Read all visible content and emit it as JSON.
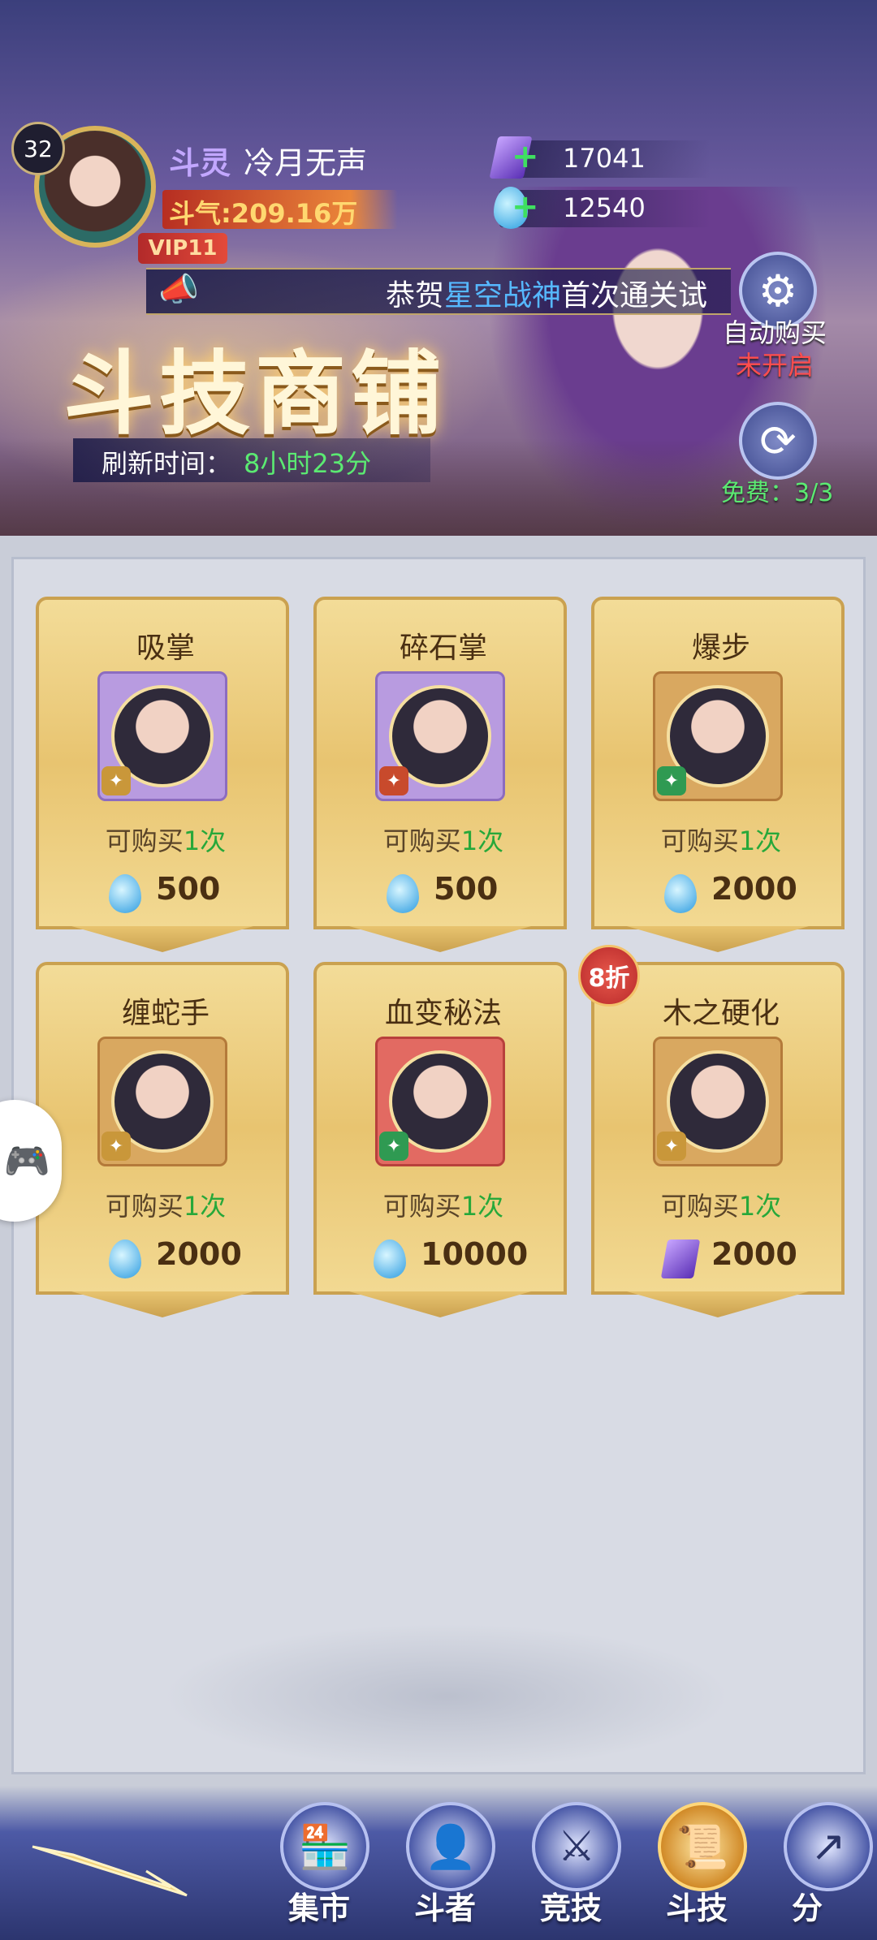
{
  "player": {
    "level": "32",
    "rank": "斗灵",
    "name": "冷月无声",
    "power": "斗气:209.16万",
    "vip": "VIP11"
  },
  "currencies": [
    {
      "icon": "purple-crystal-icon",
      "value": "17041"
    },
    {
      "icon": "blue-drop-icon",
      "value": "12540"
    }
  ],
  "notice": {
    "prefix": "恭贺",
    "highlight": "星空战神",
    "suffix": "首次通关试"
  },
  "shop": {
    "title": "斗技商铺",
    "refresh_label": "刷新时间：",
    "refresh_value": "8小时23分",
    "auto_buy_label": "自动购买",
    "auto_buy_status": "未开启",
    "free_refresh": "免费：3/3"
  },
  "items": [
    {
      "name": "吸掌",
      "limit_prefix": "可购买",
      "limit_count": "1次",
      "price": "500",
      "currency": "drop",
      "frame": "purple",
      "badge_color": "#c9973a"
    },
    {
      "name": "碎石掌",
      "limit_prefix": "可购买",
      "limit_count": "1次",
      "price": "500",
      "currency": "drop",
      "frame": "purple",
      "badge_color": "#c84a2c"
    },
    {
      "name": "爆步",
      "limit_prefix": "可购买",
      "limit_count": "1次",
      "price": "2000",
      "currency": "drop",
      "frame": "gold",
      "badge_color": "#2f9a52"
    },
    {
      "name": "缠蛇手",
      "limit_prefix": "可购买",
      "limit_count": "1次",
      "price": "2000",
      "currency": "drop",
      "frame": "gold",
      "badge_color": "#c9973a"
    },
    {
      "name": "血变秘法",
      "limit_prefix": "可购买",
      "limit_count": "1次",
      "price": "10000",
      "currency": "drop",
      "frame": "red",
      "badge_color": "#2f9a52"
    },
    {
      "name": "木之硬化",
      "limit_prefix": "可购买",
      "limit_count": "1次",
      "price": "2000",
      "currency": "gem",
      "frame": "gold",
      "badge_color": "#c9973a"
    }
  ],
  "discount": "8折",
  "nav": [
    {
      "label": "集市",
      "icon": "market-icon"
    },
    {
      "label": "斗者",
      "icon": "fighter-icon"
    },
    {
      "label": "竞技",
      "icon": "arena-icon"
    },
    {
      "label": "斗技",
      "icon": "skill-scroll-icon",
      "active": true
    },
    {
      "label": "分",
      "icon": "share-icon"
    }
  ]
}
